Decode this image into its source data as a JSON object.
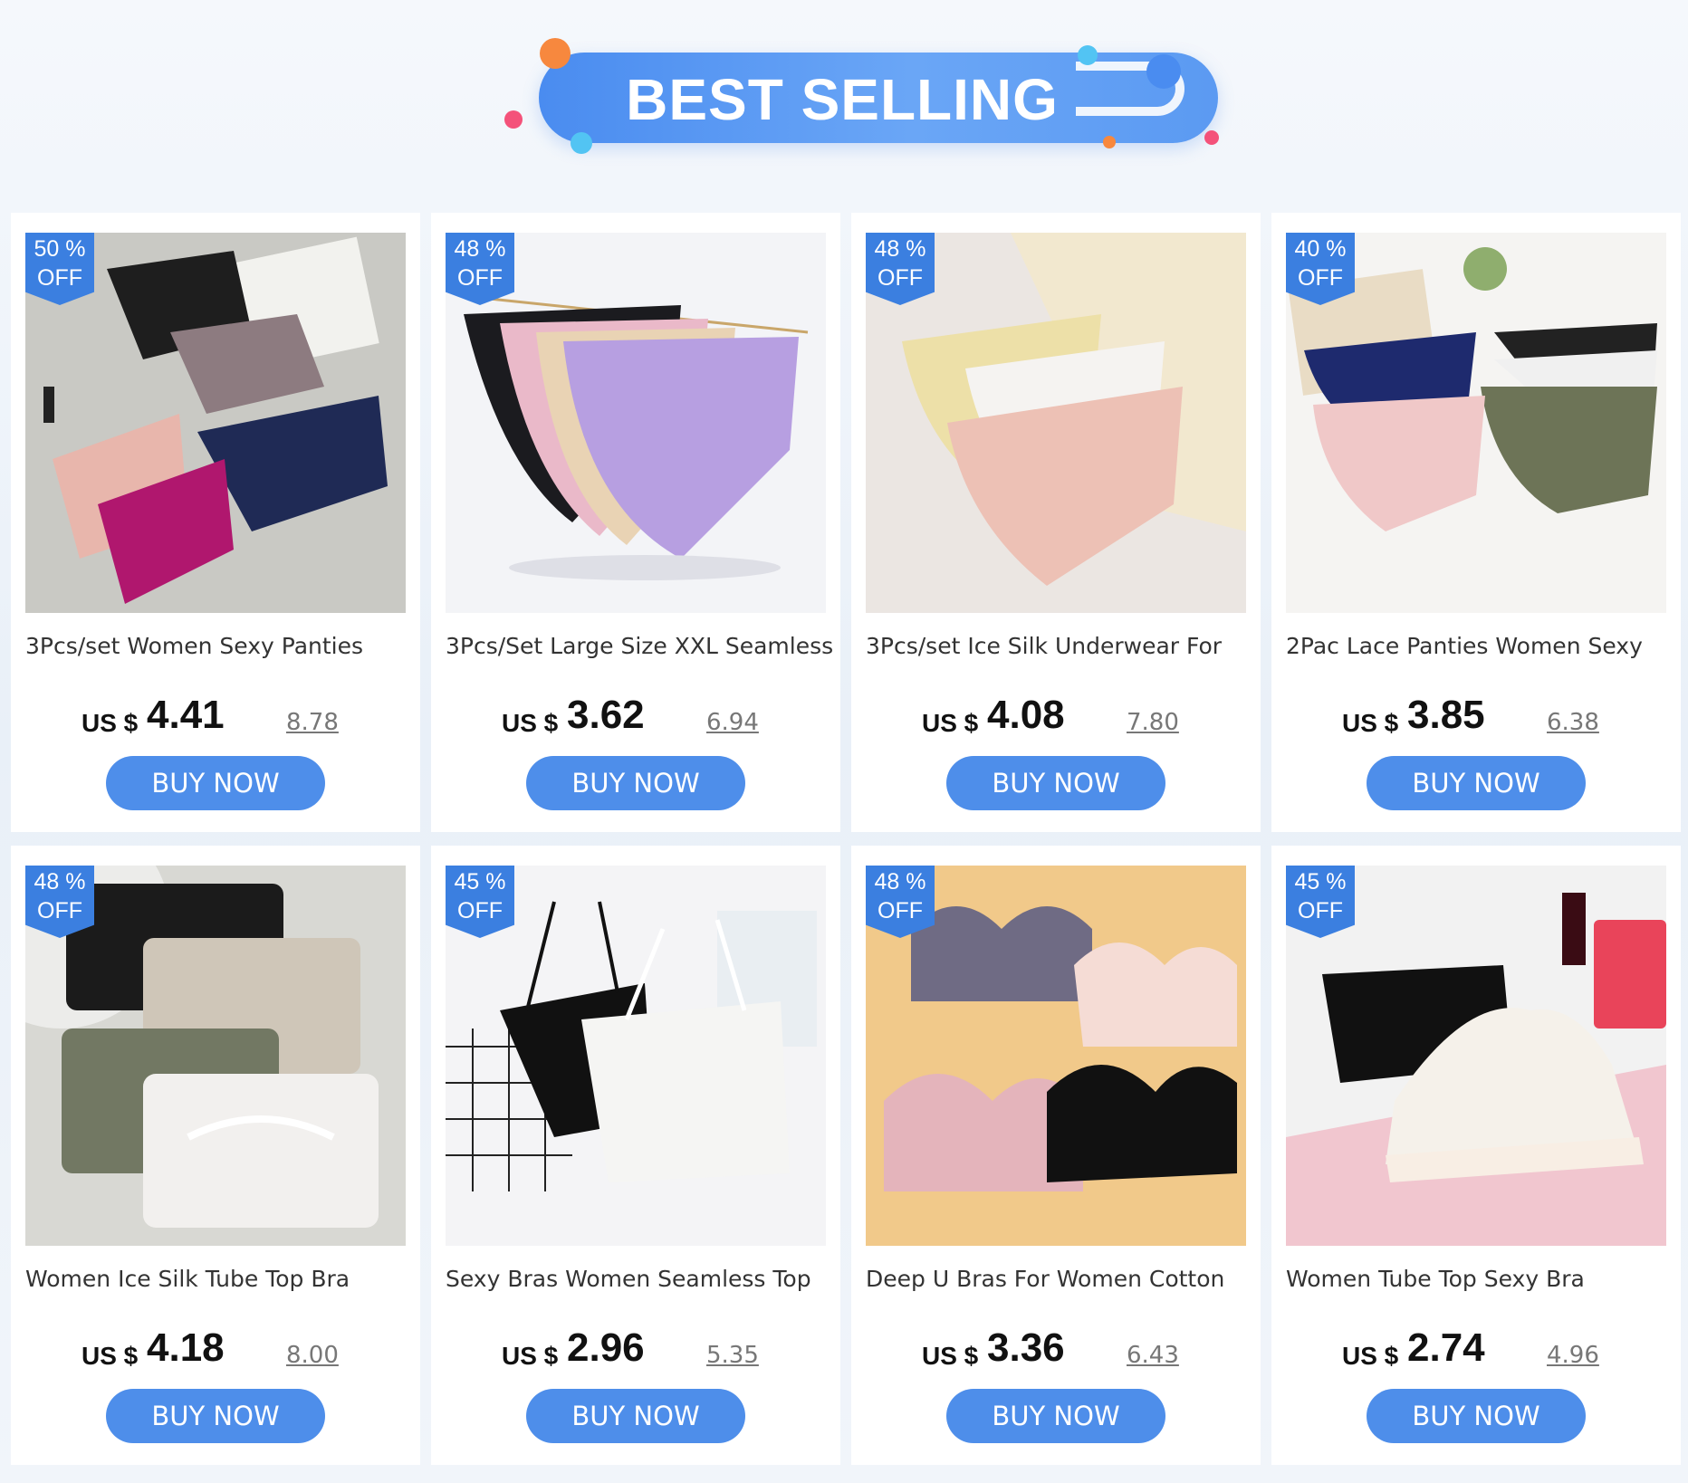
{
  "header": {
    "title": "BEST SELLING"
  },
  "colors": {
    "accent": "#4e8eea",
    "badge": "#3b7fe0",
    "banner": "#5b9af2"
  },
  "products": [
    {
      "badge_pct": "50 %",
      "badge_off": "OFF",
      "title": "3Pcs/set Women Sexy Panties",
      "currency": "US $",
      "price": "4.41",
      "old_price": "8.78",
      "button": "BUY NOW",
      "image": "panties-set-lace"
    },
    {
      "badge_pct": "48 %",
      "badge_off": "OFF",
      "title": "3Pcs/Set Large Size XXL Seamless",
      "currency": "US $",
      "price": "3.62",
      "old_price": "6.94",
      "button": "BUY NOW",
      "image": "seamless-panties-lavender"
    },
    {
      "badge_pct": "48 %",
      "badge_off": "OFF",
      "title": "3Pcs/set Ice Silk Underwear For",
      "currency": "US $",
      "price": "4.08",
      "old_price": "7.80",
      "button": "BUY NOW",
      "image": "ice-silk-panties"
    },
    {
      "badge_pct": "40 %",
      "badge_off": "OFF",
      "title": "2Pac Lace Panties Women Sexy",
      "currency": "US $",
      "price": "3.85",
      "old_price": "6.38",
      "button": "BUY NOW",
      "image": "lace-panties"
    },
    {
      "badge_pct": "48 %",
      "badge_off": "OFF",
      "title": "Women Ice Silk Tube Top Bra",
      "currency": "US $",
      "price": "4.18",
      "old_price": "8.00",
      "button": "BUY NOW",
      "image": "tube-top-bra"
    },
    {
      "badge_pct": "45 %",
      "badge_off": "OFF",
      "title": "Sexy Bras Women Seamless Top",
      "currency": "US $",
      "price": "2.96",
      "old_price": "5.35",
      "button": "BUY NOW",
      "image": "seamless-top-bra"
    },
    {
      "badge_pct": "48 %",
      "badge_off": "OFF",
      "title": "Deep U Bras For Women Cotton",
      "currency": "US $",
      "price": "3.36",
      "old_price": "6.43",
      "button": "BUY NOW",
      "image": "deep-u-bras"
    },
    {
      "badge_pct": "45 %",
      "badge_off": "OFF",
      "title": "Women Tube Top Sexy Bra",
      "currency": "US $",
      "price": "2.74",
      "old_price": "4.96",
      "button": "BUY NOW",
      "image": "satin-bra"
    }
  ]
}
